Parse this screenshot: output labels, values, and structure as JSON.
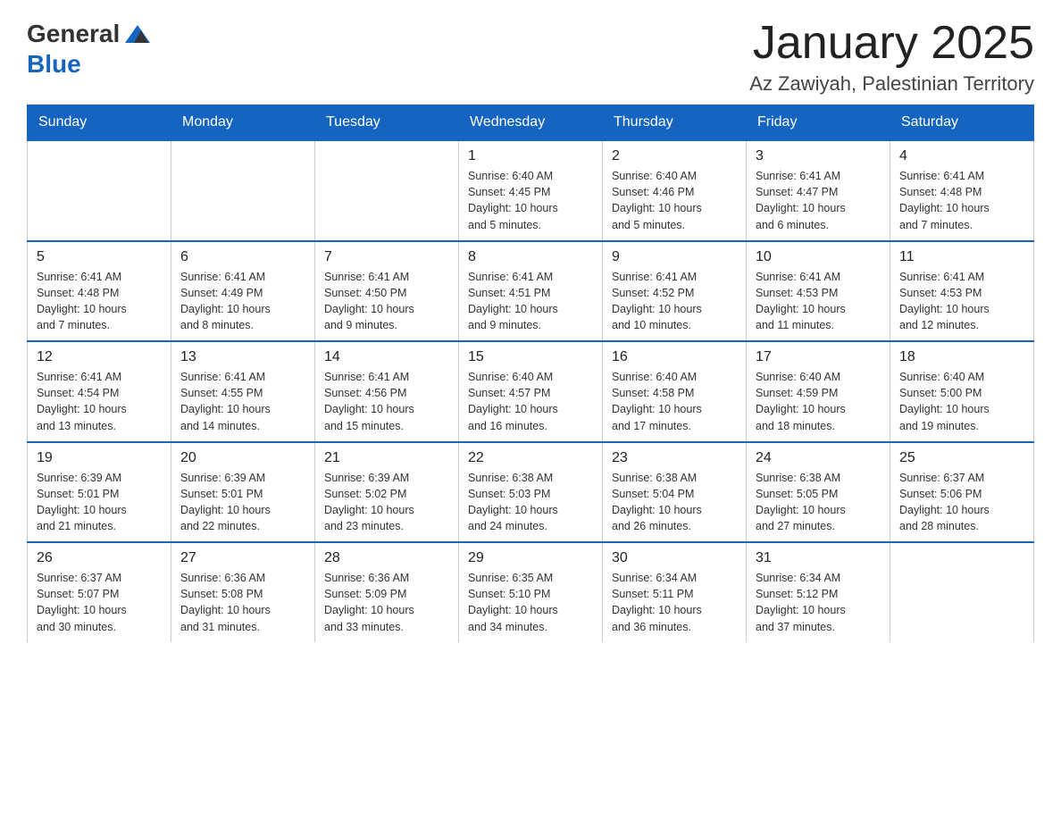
{
  "header": {
    "logo_general": "General",
    "logo_blue": "Blue",
    "title": "January 2025",
    "subtitle": "Az Zawiyah, Palestinian Territory"
  },
  "days_of_week": [
    "Sunday",
    "Monday",
    "Tuesday",
    "Wednesday",
    "Thursday",
    "Friday",
    "Saturday"
  ],
  "weeks": [
    [
      {
        "day": "",
        "info": ""
      },
      {
        "day": "",
        "info": ""
      },
      {
        "day": "",
        "info": ""
      },
      {
        "day": "1",
        "info": "Sunrise: 6:40 AM\nSunset: 4:45 PM\nDaylight: 10 hours\nand 5 minutes."
      },
      {
        "day": "2",
        "info": "Sunrise: 6:40 AM\nSunset: 4:46 PM\nDaylight: 10 hours\nand 5 minutes."
      },
      {
        "day": "3",
        "info": "Sunrise: 6:41 AM\nSunset: 4:47 PM\nDaylight: 10 hours\nand 6 minutes."
      },
      {
        "day": "4",
        "info": "Sunrise: 6:41 AM\nSunset: 4:48 PM\nDaylight: 10 hours\nand 7 minutes."
      }
    ],
    [
      {
        "day": "5",
        "info": "Sunrise: 6:41 AM\nSunset: 4:48 PM\nDaylight: 10 hours\nand 7 minutes."
      },
      {
        "day": "6",
        "info": "Sunrise: 6:41 AM\nSunset: 4:49 PM\nDaylight: 10 hours\nand 8 minutes."
      },
      {
        "day": "7",
        "info": "Sunrise: 6:41 AM\nSunset: 4:50 PM\nDaylight: 10 hours\nand 9 minutes."
      },
      {
        "day": "8",
        "info": "Sunrise: 6:41 AM\nSunset: 4:51 PM\nDaylight: 10 hours\nand 9 minutes."
      },
      {
        "day": "9",
        "info": "Sunrise: 6:41 AM\nSunset: 4:52 PM\nDaylight: 10 hours\nand 10 minutes."
      },
      {
        "day": "10",
        "info": "Sunrise: 6:41 AM\nSunset: 4:53 PM\nDaylight: 10 hours\nand 11 minutes."
      },
      {
        "day": "11",
        "info": "Sunrise: 6:41 AM\nSunset: 4:53 PM\nDaylight: 10 hours\nand 12 minutes."
      }
    ],
    [
      {
        "day": "12",
        "info": "Sunrise: 6:41 AM\nSunset: 4:54 PM\nDaylight: 10 hours\nand 13 minutes."
      },
      {
        "day": "13",
        "info": "Sunrise: 6:41 AM\nSunset: 4:55 PM\nDaylight: 10 hours\nand 14 minutes."
      },
      {
        "day": "14",
        "info": "Sunrise: 6:41 AM\nSunset: 4:56 PM\nDaylight: 10 hours\nand 15 minutes."
      },
      {
        "day": "15",
        "info": "Sunrise: 6:40 AM\nSunset: 4:57 PM\nDaylight: 10 hours\nand 16 minutes."
      },
      {
        "day": "16",
        "info": "Sunrise: 6:40 AM\nSunset: 4:58 PM\nDaylight: 10 hours\nand 17 minutes."
      },
      {
        "day": "17",
        "info": "Sunrise: 6:40 AM\nSunset: 4:59 PM\nDaylight: 10 hours\nand 18 minutes."
      },
      {
        "day": "18",
        "info": "Sunrise: 6:40 AM\nSunset: 5:00 PM\nDaylight: 10 hours\nand 19 minutes."
      }
    ],
    [
      {
        "day": "19",
        "info": "Sunrise: 6:39 AM\nSunset: 5:01 PM\nDaylight: 10 hours\nand 21 minutes."
      },
      {
        "day": "20",
        "info": "Sunrise: 6:39 AM\nSunset: 5:01 PM\nDaylight: 10 hours\nand 22 minutes."
      },
      {
        "day": "21",
        "info": "Sunrise: 6:39 AM\nSunset: 5:02 PM\nDaylight: 10 hours\nand 23 minutes."
      },
      {
        "day": "22",
        "info": "Sunrise: 6:38 AM\nSunset: 5:03 PM\nDaylight: 10 hours\nand 24 minutes."
      },
      {
        "day": "23",
        "info": "Sunrise: 6:38 AM\nSunset: 5:04 PM\nDaylight: 10 hours\nand 26 minutes."
      },
      {
        "day": "24",
        "info": "Sunrise: 6:38 AM\nSunset: 5:05 PM\nDaylight: 10 hours\nand 27 minutes."
      },
      {
        "day": "25",
        "info": "Sunrise: 6:37 AM\nSunset: 5:06 PM\nDaylight: 10 hours\nand 28 minutes."
      }
    ],
    [
      {
        "day": "26",
        "info": "Sunrise: 6:37 AM\nSunset: 5:07 PM\nDaylight: 10 hours\nand 30 minutes."
      },
      {
        "day": "27",
        "info": "Sunrise: 6:36 AM\nSunset: 5:08 PM\nDaylight: 10 hours\nand 31 minutes."
      },
      {
        "day": "28",
        "info": "Sunrise: 6:36 AM\nSunset: 5:09 PM\nDaylight: 10 hours\nand 33 minutes."
      },
      {
        "day": "29",
        "info": "Sunrise: 6:35 AM\nSunset: 5:10 PM\nDaylight: 10 hours\nand 34 minutes."
      },
      {
        "day": "30",
        "info": "Sunrise: 6:34 AM\nSunset: 5:11 PM\nDaylight: 10 hours\nand 36 minutes."
      },
      {
        "day": "31",
        "info": "Sunrise: 6:34 AM\nSunset: 5:12 PM\nDaylight: 10 hours\nand 37 minutes."
      },
      {
        "day": "",
        "info": ""
      }
    ]
  ]
}
